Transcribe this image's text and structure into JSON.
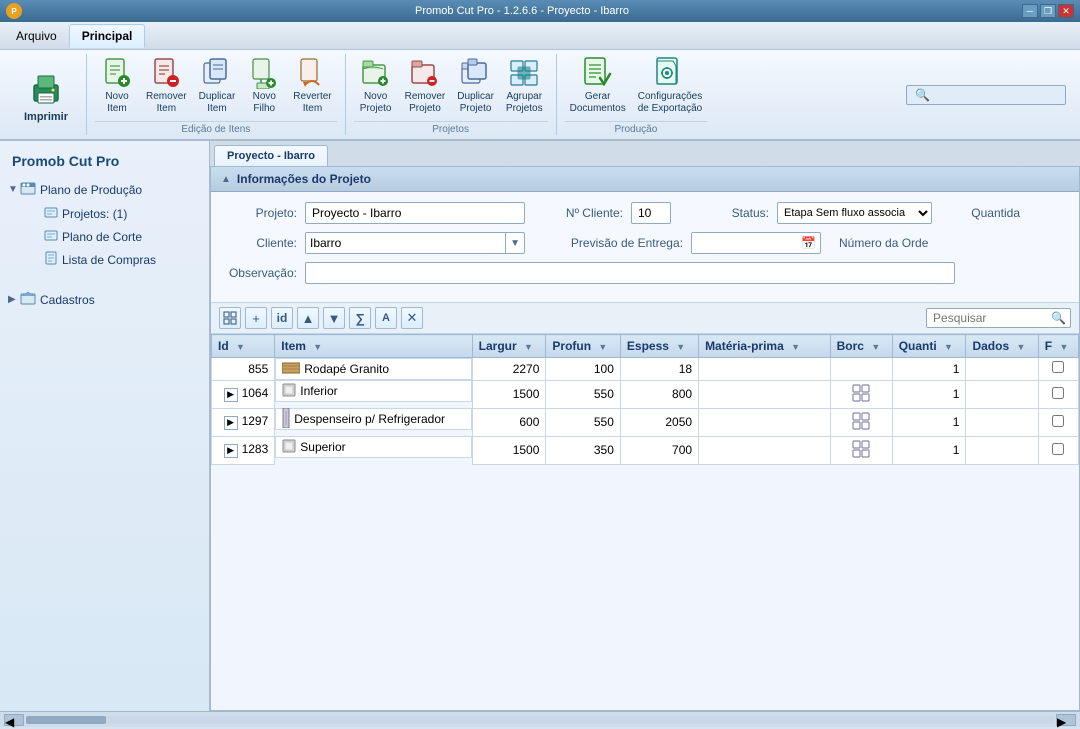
{
  "app": {
    "title": "Promob Cut Pro - 1.2.6.6 - Proyecto - Ibarro",
    "logo_text": "P"
  },
  "window_controls": {
    "minimize": "─",
    "restore": "❐",
    "close": "✕"
  },
  "menu": {
    "tabs": [
      {
        "id": "arquivo",
        "label": "Arquivo",
        "active": false
      },
      {
        "id": "principal",
        "label": "Principal",
        "active": true
      }
    ]
  },
  "ribbon": {
    "sections": [
      {
        "id": "imprimir-section",
        "buttons": [
          {
            "id": "imprimir",
            "label": "Imprimir",
            "icon": "🖨",
            "icon_color": "icon-teal",
            "large": true
          }
        ],
        "section_label": ""
      },
      {
        "id": "edicao-itens",
        "label": "Edição de Itens",
        "buttons": [
          {
            "id": "novo-item",
            "label": "Novo\nItem",
            "icon": "📄",
            "icon_color": "icon-green"
          },
          {
            "id": "remover-item",
            "label": "Remover\nItem",
            "icon": "📄",
            "icon_color": "icon-red"
          },
          {
            "id": "duplicar-item",
            "label": "Duplicar\nItem",
            "icon": "📄",
            "icon_color": "icon-blue"
          },
          {
            "id": "novo-filho",
            "label": "Novo\nFilho",
            "icon": "📄",
            "icon_color": "icon-green"
          },
          {
            "id": "reverter-item",
            "label": "Reverter\nItem",
            "icon": "📄",
            "icon_color": "icon-orange"
          }
        ]
      },
      {
        "id": "projetos",
        "label": "Projetos",
        "buttons": [
          {
            "id": "novo-projeto",
            "label": "Novo\nProjeto",
            "icon": "📁",
            "icon_color": "icon-green"
          },
          {
            "id": "remover-projeto",
            "label": "Remover\nProjeto",
            "icon": "📁",
            "icon_color": "icon-red"
          },
          {
            "id": "duplicar-projeto",
            "label": "Duplicar\nProjeto",
            "icon": "📁",
            "icon_color": "icon-blue"
          },
          {
            "id": "agrupar-projetos",
            "label": "Agrupar\nProjetos",
            "icon": "📁",
            "icon_color": "icon-teal"
          }
        ]
      },
      {
        "id": "producao",
        "label": "Produção",
        "buttons": [
          {
            "id": "gerar-documentos",
            "label": "Gerar\nDocumentos",
            "icon": "📋",
            "icon_color": "icon-green"
          },
          {
            "id": "configuracoes-exportacao",
            "label": "Configurações\nde Exportação",
            "icon": "⚙",
            "icon_color": "icon-teal"
          }
        ]
      }
    ]
  },
  "sidebar": {
    "title": "Promob Cut Pro",
    "tree": {
      "root_label": "Plano de Produção",
      "root_icon": "🏭",
      "children": [
        {
          "id": "projetos",
          "label": "Projetos: (1)",
          "icon": "📄",
          "active": true
        },
        {
          "id": "plano-corte",
          "label": "Plano de Corte",
          "icon": "📄"
        },
        {
          "id": "lista-compras",
          "label": "Lista de Compras",
          "icon": "📋"
        }
      ]
    },
    "cadastros": {
      "label": "Cadastros",
      "icon": "📁"
    }
  },
  "content": {
    "active_tab": "Proyecto - Ibarro",
    "project_section": {
      "title": "Informações do Projeto",
      "fields": {
        "projeto_label": "Projeto:",
        "projeto_value": "Proyecto - Ibarro",
        "no_cliente_label": "Nº Cliente:",
        "no_cliente_value": "10",
        "status_label": "Status:",
        "status_value": "Etapa Sem fluxo associa",
        "quantidade_label": "Quantida",
        "cliente_label": "Cliente:",
        "cliente_value": "Ibarro",
        "previsao_label": "Previsão de Entrega:",
        "numero_ordem_label": "Número da Orde",
        "observacao_label": "Observação:"
      }
    },
    "toolbar": {
      "buttons": [
        {
          "id": "grid-view",
          "icon": "⊞",
          "label": "grid-view"
        },
        {
          "id": "add-row",
          "icon": "+",
          "label": "add-row"
        },
        {
          "id": "edit-row",
          "icon": "✎",
          "label": "edit-row"
        },
        {
          "id": "move-up",
          "icon": "▲",
          "label": "move-up"
        },
        {
          "id": "move-down",
          "icon": "▼",
          "label": "move-down"
        },
        {
          "id": "filter1",
          "icon": "🔤",
          "label": "filter1"
        },
        {
          "id": "filter2",
          "icon": "A",
          "label": "filter2"
        },
        {
          "id": "clear",
          "icon": "✕",
          "label": "clear"
        }
      ],
      "search_placeholder": "Pesquisar"
    },
    "table": {
      "columns": [
        {
          "id": "id",
          "label": "Id"
        },
        {
          "id": "item",
          "label": "Item"
        },
        {
          "id": "largura",
          "label": "Largur"
        },
        {
          "id": "profundidade",
          "label": "Profun"
        },
        {
          "id": "espessura",
          "label": "Espess"
        },
        {
          "id": "materia-prima",
          "label": "Matéria-prima"
        },
        {
          "id": "borda",
          "label": "Borc"
        },
        {
          "id": "quantidade",
          "label": "Quanti"
        },
        {
          "id": "dados",
          "label": "Dados"
        },
        {
          "id": "f",
          "label": "F"
        }
      ],
      "rows": [
        {
          "id": "855",
          "expand": false,
          "item_icon": "🔲",
          "item_name": "Rodapé Granito",
          "largura": "2270",
          "profundidade": "100",
          "espessura": "18",
          "materia_prima": "",
          "borda": "",
          "borda_visual": false,
          "quantidade": "1",
          "dados": "",
          "f": false
        },
        {
          "id": "1064",
          "expand": true,
          "item_icon": "⬜",
          "item_name": "Inferior",
          "largura": "1500",
          "profundidade": "550",
          "espessura": "800",
          "materia_prima": "",
          "borda": "",
          "borda_visual": true,
          "quantidade": "1",
          "dados": "",
          "f": false
        },
        {
          "id": "1297",
          "expand": true,
          "item_icon": "📏",
          "item_name": "Despenseiro p/ Refrigerador",
          "largura": "600",
          "profundidade": "550",
          "espessura": "2050",
          "materia_prima": "",
          "borda": "",
          "borda_visual": true,
          "quantidade": "1",
          "dados": "",
          "f": false
        },
        {
          "id": "1283",
          "expand": true,
          "item_icon": "⬜",
          "item_name": "Superior",
          "largura": "1500",
          "profundidade": "350",
          "espessura": "700",
          "materia_prima": "",
          "borda": "",
          "borda_visual": true,
          "quantidade": "1",
          "dados": "",
          "f": false
        }
      ]
    }
  }
}
